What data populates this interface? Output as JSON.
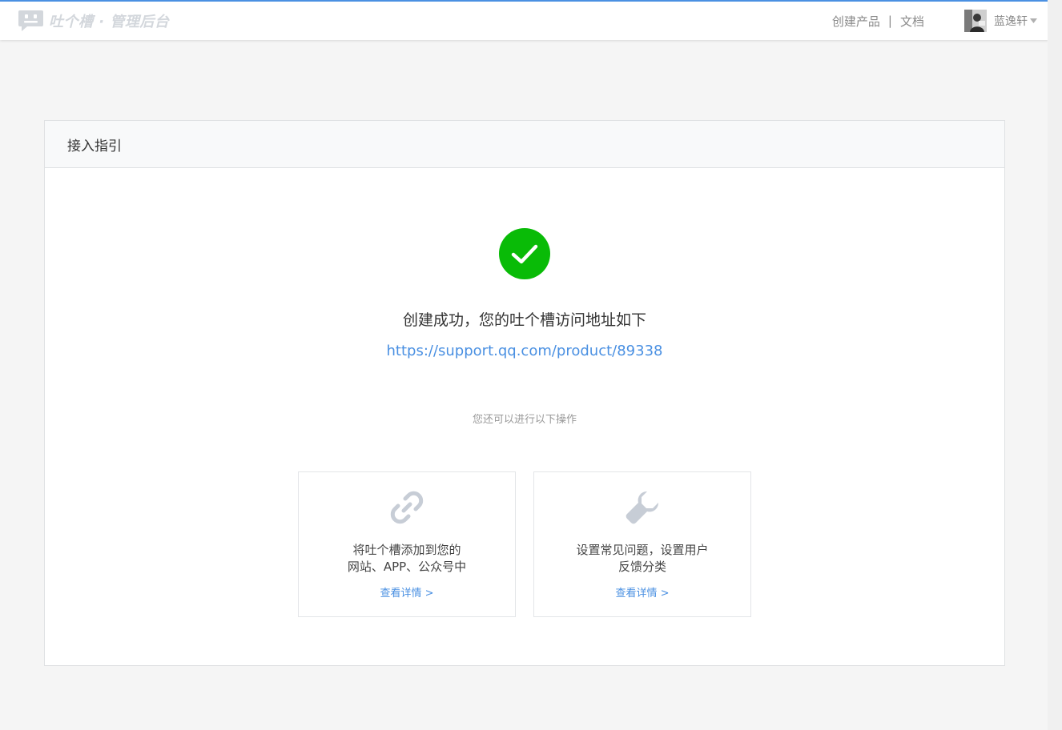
{
  "header": {
    "brand": "吐个槽 · 管理后台",
    "nav": {
      "create_product": "创建产品",
      "separator": "|",
      "docs": "文档"
    },
    "user": {
      "name": "蓝逸轩"
    }
  },
  "panel": {
    "title": "接入指引",
    "success_message": "创建成功，您的吐个槽访问地址如下",
    "access_url": "https://support.qq.com/product/89338",
    "hint": "您还可以进行以下操作",
    "cards": [
      {
        "icon": "link-icon",
        "line1": "将吐个槽添加到您的",
        "line2": "网站、APP、公众号中",
        "link": "查看详情 >"
      },
      {
        "icon": "wrench-icon",
        "line1": "设置常见问题，设置用户",
        "line2": "反馈分类",
        "link": "查看详情 >"
      }
    ]
  },
  "colors": {
    "accent": "#4a90e2",
    "success": "#09bb07",
    "icon_muted": "#c7cdd6",
    "logo_muted": "#d3d7dc"
  }
}
